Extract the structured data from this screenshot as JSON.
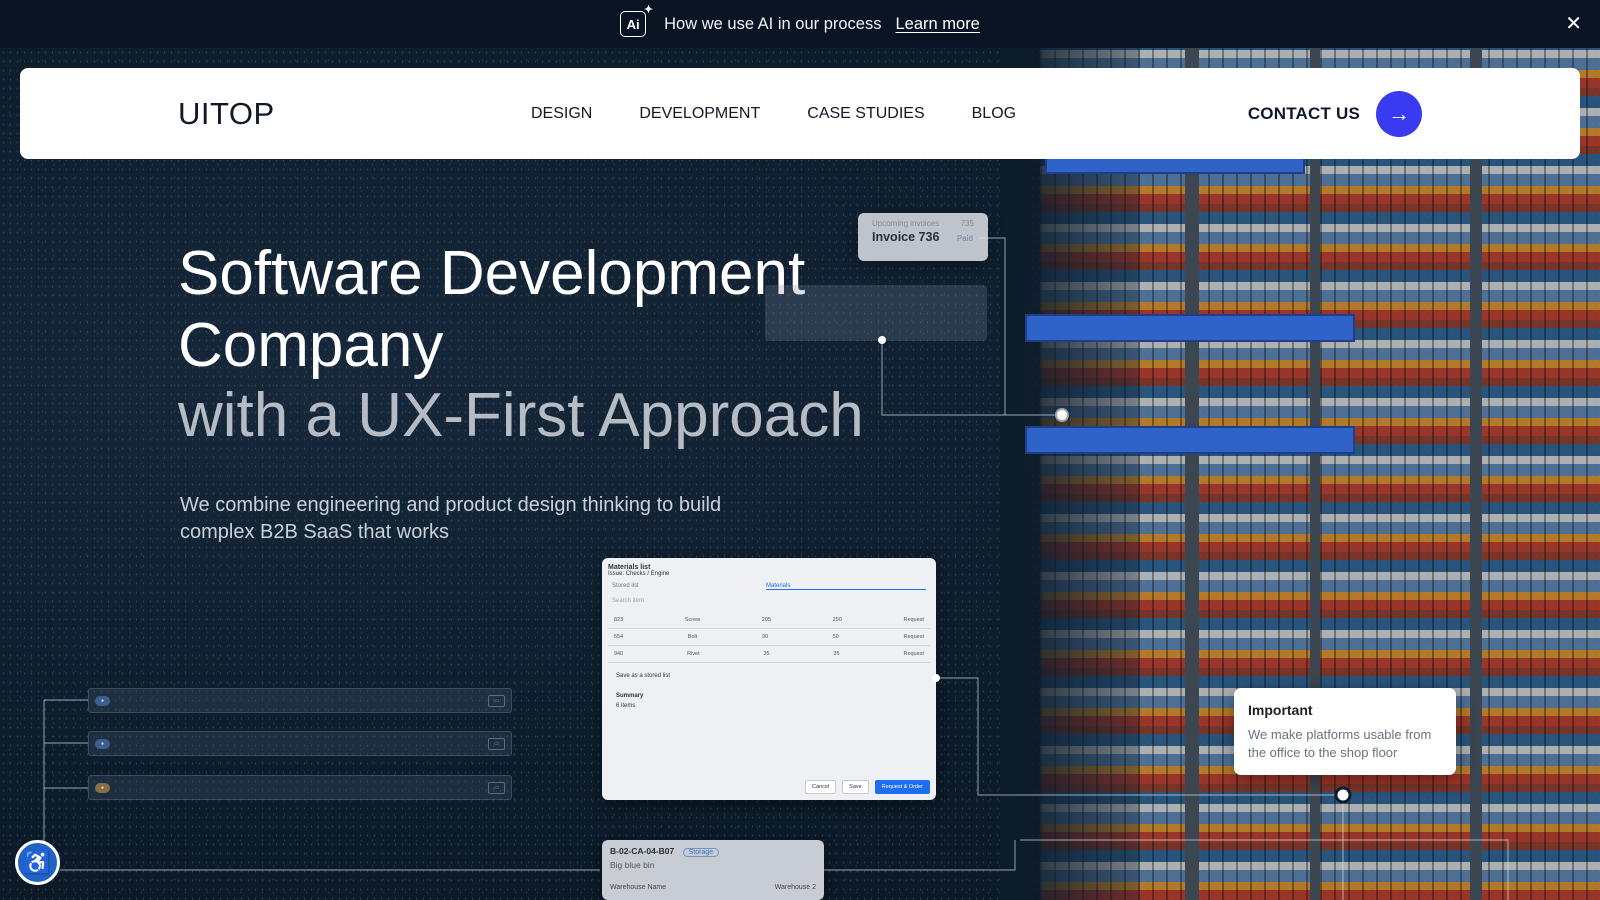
{
  "banner": {
    "icon": "ai-sparkle-icon",
    "icon_text": "Ai",
    "message": "How we use AI in our process",
    "link": "Learn more",
    "close": "✕"
  },
  "nav": {
    "logo": "UITOP",
    "menu": [
      "DESIGN",
      "DEVELOPMENT",
      "CASE STUDIES",
      "BLOG"
    ],
    "contact_label": "CONTACT US",
    "contact_icon": "arrow-right-icon"
  },
  "hero": {
    "title_line1": "Software Development",
    "title_line2": "Company",
    "title_line3": "with a UX-First Approach",
    "subtitle": "We combine engineering and product design thinking to build complex B2B SaaS that works"
  },
  "invoice_card": {
    "top_label": "Upcoming invoices",
    "top_value": "735",
    "title": "Invoice 736",
    "status": "Paid"
  },
  "materials_card": {
    "title": "Materials list",
    "subtitle": "Issue: Checks / Engine",
    "step1": "Stored list",
    "step2": "Materials",
    "search": "Search item",
    "rows": [
      [
        "823",
        "Screw",
        "205",
        "250",
        "Request"
      ],
      [
        "554",
        "Bolt",
        "90",
        "50",
        "Request"
      ],
      [
        "940",
        "Rivet",
        "35",
        "35",
        "Request"
      ]
    ],
    "save_label": "Save as a stored list",
    "summary": "Summary",
    "items": "6 items",
    "cancel": "Cancel",
    "save": "Save",
    "request": "Request & Order"
  },
  "bin_card": {
    "code": "B-02-CA-04-B07",
    "tag": "Storage",
    "name": "Big blue bin",
    "warehouse_label": "Warehouse Name",
    "warehouse_value": "Warehouse 2"
  },
  "important_card": {
    "title": "Important",
    "text": "We make platforms usable from the office to the shop floor"
  },
  "accessibility_icon": "accessibility-icon",
  "colors": {
    "accent": "#3a3af0",
    "banner_bg": "#0b1424",
    "hero_bg": "#0d1c2b"
  }
}
